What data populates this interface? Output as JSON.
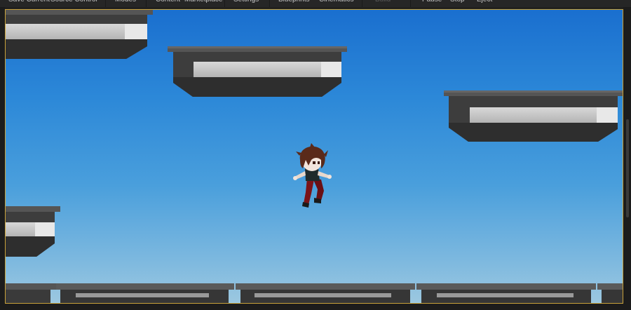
{
  "toolbar": {
    "items": [
      {
        "label": "Save Current",
        "disabled": false
      },
      {
        "label": "Source Control",
        "disabled": false
      },
      {
        "label": "Modes",
        "disabled": false
      },
      {
        "label": "Content",
        "disabled": false
      },
      {
        "label": "Marketplace",
        "disabled": false
      },
      {
        "label": "Settings",
        "disabled": false
      },
      {
        "label": "Blueprints",
        "disabled": false
      },
      {
        "label": "Cinematics",
        "disabled": false
      },
      {
        "label": "Build",
        "disabled": true
      },
      {
        "label": "Pause",
        "disabled": false
      },
      {
        "label": "Stop",
        "disabled": false
      },
      {
        "label": "Eject",
        "disabled": false
      }
    ]
  },
  "viewport": {
    "sky_top": "#1a6fcf",
    "sky_bottom": "#9cc8e0",
    "frame_color": "#c9a23a"
  },
  "character": {
    "hair": "#5a2a1a",
    "shirt": "#1f2a2a",
    "pants": "#6a0f14"
  }
}
